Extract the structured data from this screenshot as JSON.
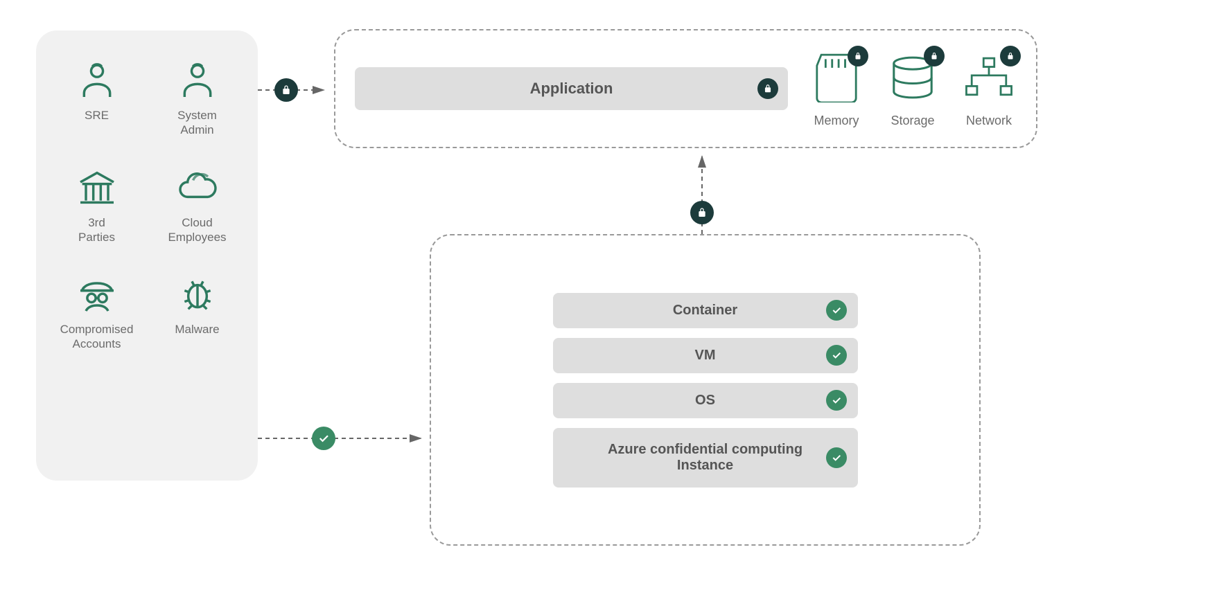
{
  "actors": {
    "sre": "SRE",
    "sysadmin": "System\nAdmin",
    "third": "3rd\nParties",
    "cloud": "Cloud\nEmployees",
    "comp": "Compromised\nAccounts",
    "malware": "Malware"
  },
  "top": {
    "app": "Application",
    "memory": "Memory",
    "storage": "Storage",
    "network": "Network"
  },
  "layers": {
    "container": "Container",
    "vm": "VM",
    "os": "OS",
    "azure": "Azure confidential computing Instance"
  }
}
